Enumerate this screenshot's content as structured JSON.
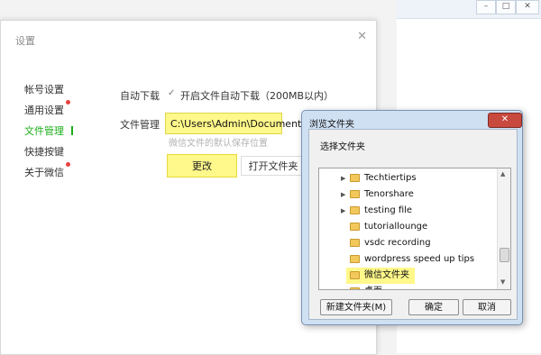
{
  "background_window": {
    "minimize_icon": "minimize-icon",
    "maximize_icon": "maximize-icon",
    "close_icon": "close-icon"
  },
  "settings": {
    "title": "设置",
    "nav": [
      {
        "label": "帐号设置",
        "badge": false
      },
      {
        "label": "通用设置",
        "badge": true
      },
      {
        "label": "文件管理",
        "badge": false,
        "active": true
      },
      {
        "label": "快捷按键",
        "badge": false
      },
      {
        "label": "关于微信",
        "badge": true
      }
    ],
    "auto_download_label": "自动下载",
    "auto_download_option": "开启文件自动下载（200MB以内）",
    "file_manage_label": "文件管理",
    "path_value": "C:\\Users\\Admin\\Documents",
    "path_hint": "微信文件的默认保存位置",
    "change_button": "更改",
    "open_folder_button": "打开文件夹",
    "accent_color": "#1aad19",
    "highlight_color": "#fff88a"
  },
  "browse_dialog": {
    "title": "浏览文件夹",
    "subtitle": "选择文件夹",
    "items": [
      {
        "name": "Techtiertips",
        "expandable": true
      },
      {
        "name": "Tenorshare",
        "expandable": true
      },
      {
        "name": "testing file",
        "expandable": true
      },
      {
        "name": "tutoriallounge",
        "expandable": false
      },
      {
        "name": "vsdc recording",
        "expandable": false
      },
      {
        "name": "wordpress speed up tips",
        "expandable": false
      },
      {
        "name": "微信文件夹",
        "expandable": false,
        "selected": true
      },
      {
        "name": "桌面",
        "expandable": false
      }
    ],
    "new_folder_button": "新建文件夹(M)",
    "ok_button": "确定",
    "cancel_button": "取消"
  }
}
